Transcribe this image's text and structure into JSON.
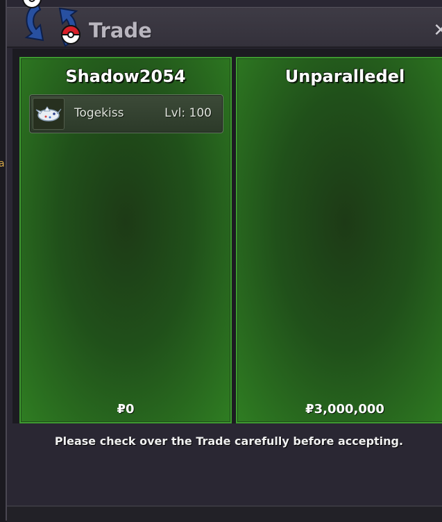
{
  "window": {
    "title": "Trade",
    "close_glyph": "✕"
  },
  "left_edge_fragment": "a",
  "trainers": {
    "left": {
      "name": "Shadow2054",
      "pokemon": {
        "name": "Togekiss",
        "level": "Lvl: 100",
        "icon": "togekiss-icon"
      },
      "money": "₽0"
    },
    "right": {
      "name": "Unparalledel",
      "money": "₽3,000,000"
    }
  },
  "notice": "Please check over the Trade carefully before accepting.",
  "colors": {
    "panel_border": "#3e9a30",
    "panel_fill": "#20501a",
    "window_bg": "#2a2733",
    "pokeball_red": "#d8202a",
    "arrow_blue": "#2850a0"
  }
}
